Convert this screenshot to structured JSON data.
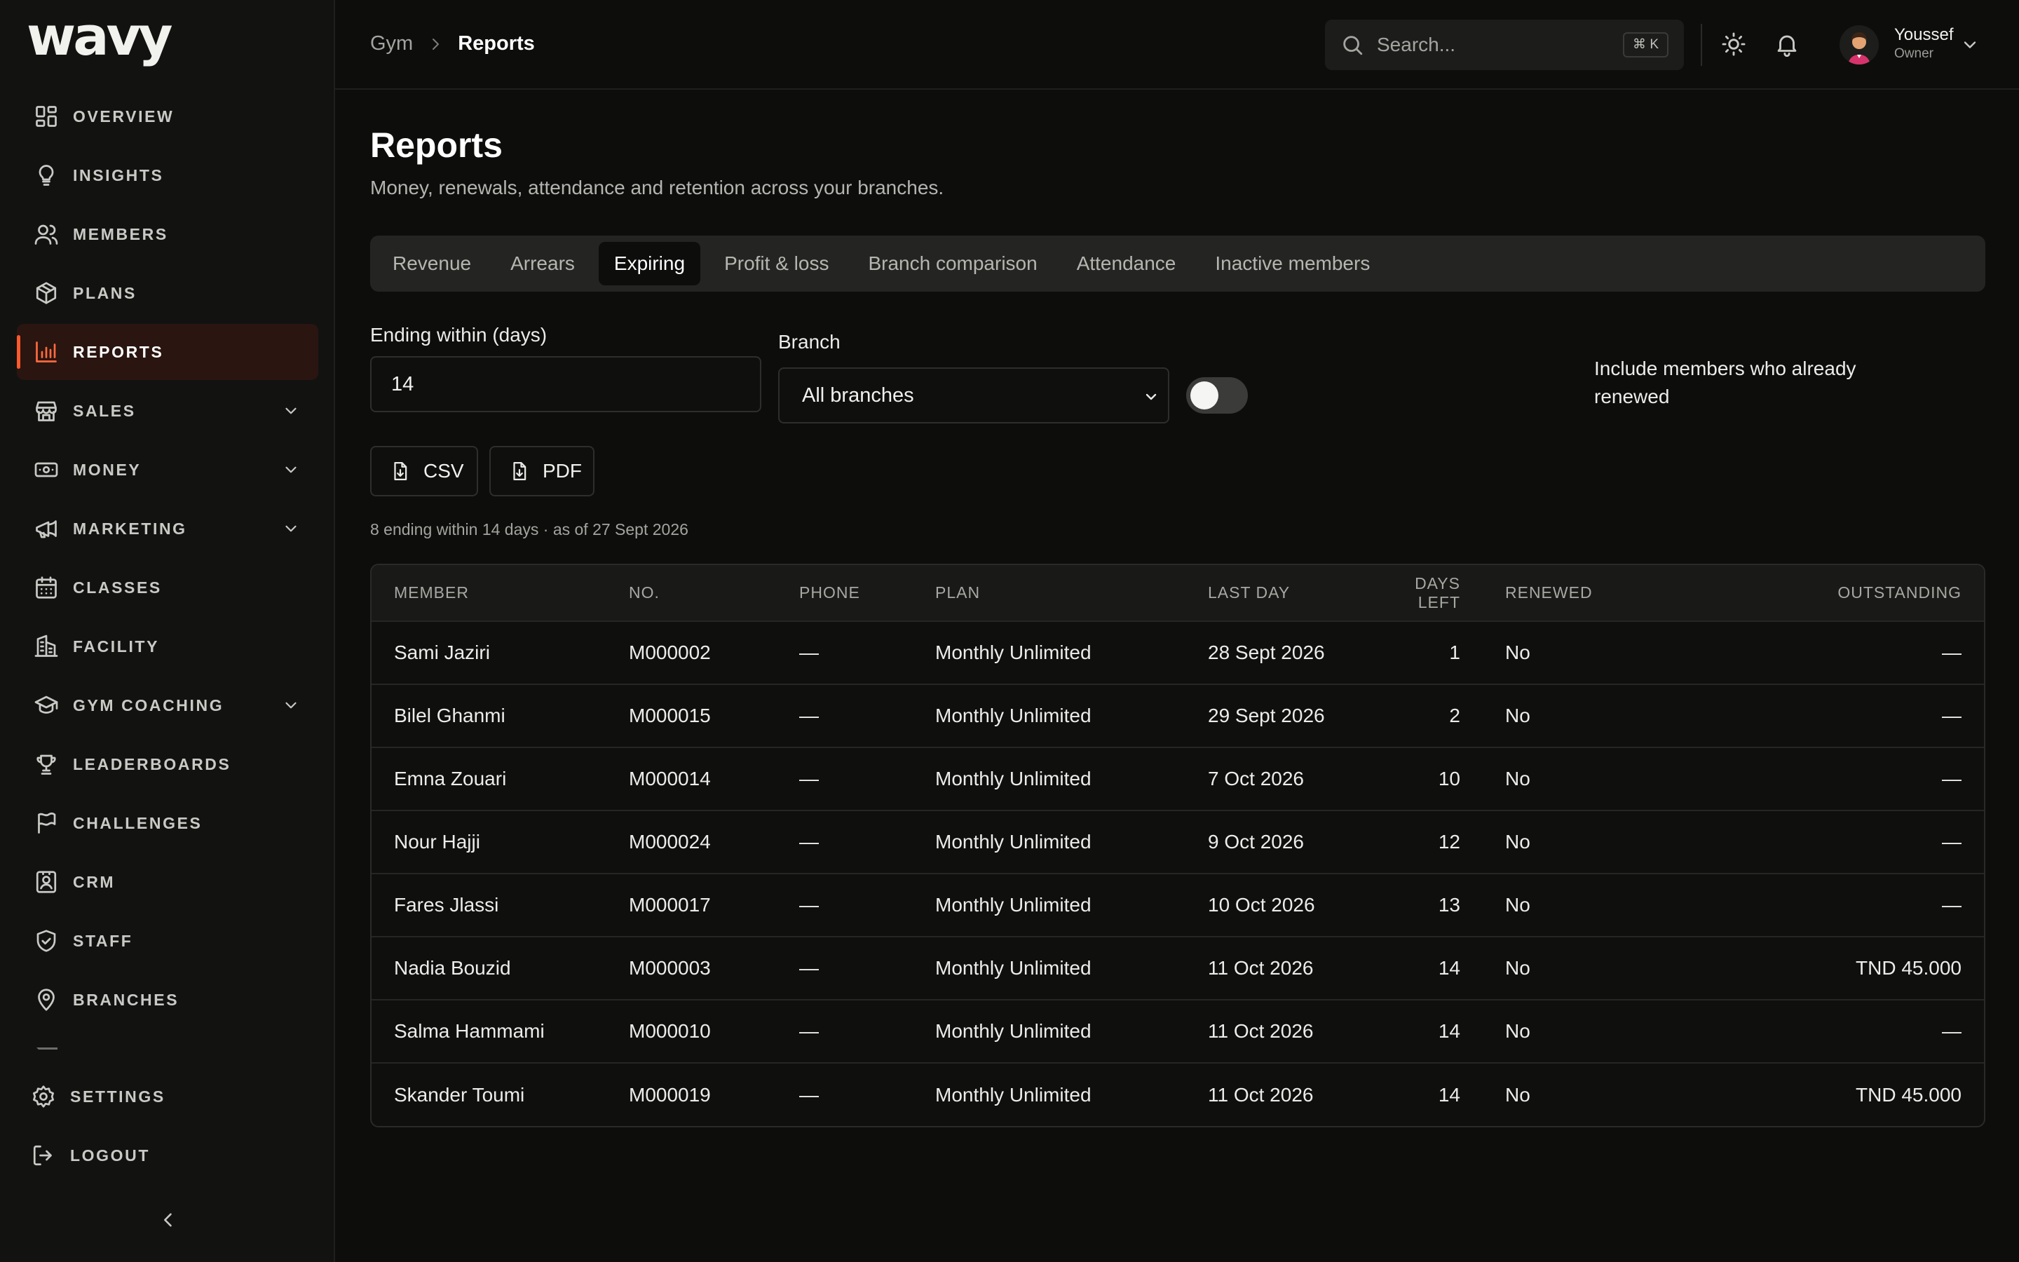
{
  "app": {
    "logo": "wavy"
  },
  "sidebar": {
    "items": [
      {
        "label": "OVERVIEW",
        "icon": "grid-icon"
      },
      {
        "label": "INSIGHTS",
        "icon": "lightbulb-icon"
      },
      {
        "label": "MEMBERS",
        "icon": "users-icon"
      },
      {
        "label": "PLANS",
        "icon": "package-icon"
      },
      {
        "label": "REPORTS",
        "icon": "bar-chart-icon",
        "active": true
      },
      {
        "label": "SALES",
        "icon": "store-icon",
        "expandable": true
      },
      {
        "label": "MONEY",
        "icon": "banknote-icon",
        "expandable": true
      },
      {
        "label": "MARKETING",
        "icon": "megaphone-icon",
        "expandable": true
      },
      {
        "label": "CLASSES",
        "icon": "calendar-icon"
      },
      {
        "label": "FACILITY",
        "icon": "building-icon"
      },
      {
        "label": "GYM COACHING",
        "icon": "graduation-cap-icon",
        "expandable": true
      },
      {
        "label": "LEADERBOARDS",
        "icon": "trophy-icon"
      },
      {
        "label": "CHALLENGES",
        "icon": "flag-icon"
      },
      {
        "label": "CRM",
        "icon": "contact-card-icon"
      },
      {
        "label": "STAFF",
        "icon": "shield-check-icon"
      },
      {
        "label": "BRANCHES",
        "icon": "map-pin-icon"
      }
    ],
    "bottom": [
      {
        "label": "SETTINGS",
        "icon": "gear-icon"
      },
      {
        "label": "LOGOUT",
        "icon": "logout-icon"
      }
    ]
  },
  "topbar": {
    "breadcrumb": {
      "root": "Gym",
      "current": "Reports"
    },
    "search": {
      "placeholder": "Search...",
      "shortcut": "⌘ K"
    },
    "user": {
      "name": "Youssef",
      "role": "Owner"
    }
  },
  "page": {
    "title": "Reports",
    "subtitle": "Money, renewals, attendance and retention across your branches."
  },
  "tabs": [
    {
      "label": "Revenue"
    },
    {
      "label": "Arrears"
    },
    {
      "label": "Expiring",
      "active": true
    },
    {
      "label": "Profit & loss"
    },
    {
      "label": "Branch comparison"
    },
    {
      "label": "Attendance"
    },
    {
      "label": "Inactive members"
    }
  ],
  "filters": {
    "ending_label": "Ending within (days)",
    "ending_value": "14",
    "branch_label": "Branch",
    "branch_value": "All branches",
    "toggle_label": "Include members who already renewed",
    "toggle_on": false
  },
  "actions": {
    "csv": "CSV",
    "pdf": "PDF"
  },
  "summary": "8 ending within 14 days · as of 27 Sept 2026",
  "table": {
    "headers": [
      "MEMBER",
      "NO.",
      "PHONE",
      "PLAN",
      "LAST DAY",
      "DAYS LEFT",
      "RENEWED",
      "OUTSTANDING"
    ],
    "rows": [
      [
        "Sami Jaziri",
        "M000002",
        "—",
        "Monthly Unlimited",
        "28 Sept 2026",
        "1",
        "No",
        "—"
      ],
      [
        "Bilel Ghanmi",
        "M000015",
        "—",
        "Monthly Unlimited",
        "29 Sept 2026",
        "2",
        "No",
        "—"
      ],
      [
        "Emna Zouari",
        "M000014",
        "—",
        "Monthly Unlimited",
        "7 Oct 2026",
        "10",
        "No",
        "—"
      ],
      [
        "Nour Hajji",
        "M000024",
        "—",
        "Monthly Unlimited",
        "9 Oct 2026",
        "12",
        "No",
        "—"
      ],
      [
        "Fares Jlassi",
        "M000017",
        "—",
        "Monthly Unlimited",
        "10 Oct 2026",
        "13",
        "No",
        "—"
      ],
      [
        "Nadia Bouzid",
        "M000003",
        "—",
        "Monthly Unlimited",
        "11 Oct 2026",
        "14",
        "No",
        "TND 45.000"
      ],
      [
        "Salma Hammami",
        "M000010",
        "—",
        "Monthly Unlimited",
        "11 Oct 2026",
        "14",
        "No",
        "—"
      ],
      [
        "Skander Toumi",
        "M000019",
        "—",
        "Monthly Unlimited",
        "11 Oct 2026",
        "14",
        "No",
        "TND 45.000"
      ]
    ]
  },
  "colors": {
    "accent": "#ff5a2c",
    "background": "#0d0e0c",
    "sidebar": "#121311"
  }
}
